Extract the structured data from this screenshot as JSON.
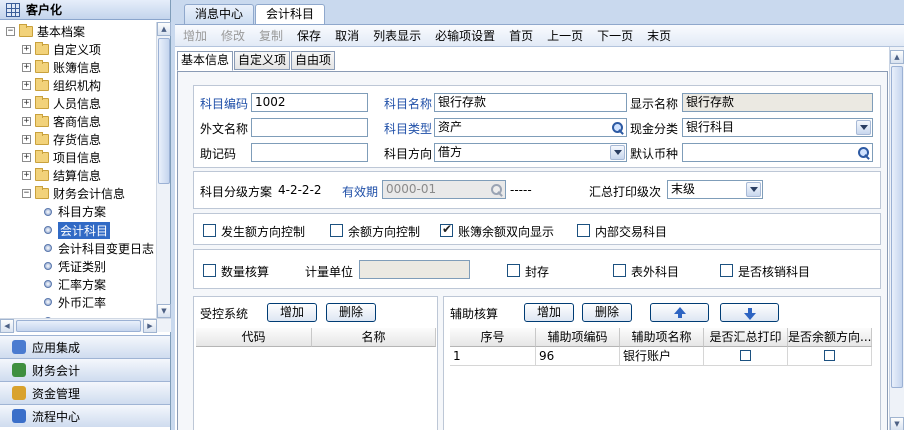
{
  "left_header": "客户化",
  "tree": [
    {
      "label": "基本档案",
      "level": 0,
      "toggle": "−",
      "type": "folder"
    },
    {
      "label": "自定义项",
      "level": 1,
      "toggle": "+",
      "type": "folder"
    },
    {
      "label": "账簿信息",
      "level": 1,
      "toggle": "+",
      "type": "folder"
    },
    {
      "label": "组织机构",
      "level": 1,
      "toggle": "+",
      "type": "folder"
    },
    {
      "label": "人员信息",
      "level": 1,
      "toggle": "+",
      "type": "folder"
    },
    {
      "label": "客商信息",
      "level": 1,
      "toggle": "+",
      "type": "folder"
    },
    {
      "label": "存货信息",
      "level": 1,
      "toggle": "+",
      "type": "folder"
    },
    {
      "label": "项目信息",
      "level": 1,
      "toggle": "+",
      "type": "folder"
    },
    {
      "label": "结算信息",
      "level": 1,
      "toggle": "+",
      "type": "folder"
    },
    {
      "label": "财务会计信息",
      "level": 1,
      "toggle": "−",
      "type": "folder"
    },
    {
      "label": "科目方案",
      "level": 2,
      "type": "leaf"
    },
    {
      "label": "会计科目",
      "level": 2,
      "type": "leaf",
      "selected": true
    },
    {
      "label": "会计科目变更日志",
      "level": 2,
      "type": "leaf"
    },
    {
      "label": "凭证类别",
      "level": 2,
      "type": "leaf"
    },
    {
      "label": "汇率方案",
      "level": 2,
      "type": "leaf"
    },
    {
      "label": "外币汇率",
      "level": 2,
      "type": "leaf"
    },
    {
      "label": "...",
      "level": 2,
      "type": "leaf"
    }
  ],
  "nav_bars": [
    {
      "label": "应用集成",
      "color": "#4a7bd0"
    },
    {
      "label": "财务会计",
      "color": "#3f8f3f"
    },
    {
      "label": "资金管理",
      "color": "#d9a22d"
    },
    {
      "label": "流程中心",
      "color": "#3b6fc9"
    }
  ],
  "tabs": [
    "消息中心",
    "会计科目"
  ],
  "toolbar": [
    {
      "label": "增加",
      "disabled": true
    },
    {
      "label": "修改",
      "disabled": true
    },
    {
      "label": "复制",
      "disabled": true
    },
    {
      "label": "保存",
      "disabled": false
    },
    {
      "label": "取消",
      "disabled": false
    },
    {
      "label": "列表显示",
      "disabled": false
    },
    {
      "label": "必输项设置",
      "disabled": false
    },
    {
      "label": "首页",
      "disabled": false
    },
    {
      "label": "上一页",
      "disabled": false
    },
    {
      "label": "下一页",
      "disabled": false
    },
    {
      "label": "末页",
      "disabled": false
    }
  ],
  "subtabs": [
    "基本信息",
    "自定义项",
    "自由项"
  ],
  "form": {
    "code_label": "科目编码",
    "code_value": "1002",
    "name_label": "科目名称",
    "name_value": "银行存款",
    "display_label": "显示名称",
    "display_value": "银行存款",
    "foreign_label": "外文名称",
    "foreign_value": "",
    "type_label": "科目类型",
    "type_value": "资产",
    "cash_label": "现金分类",
    "cash_value": "银行科目",
    "mnemonic_label": "助记码",
    "mnemonic_value": "",
    "direction_label": "科目方向",
    "direction_value": "借方",
    "currency_label": "默认币种",
    "currency_value": "",
    "level_scheme_label": "科目分级方案",
    "level_scheme_value": "4-2-2-2",
    "valid_label": "有效期",
    "valid_from": "0000-01",
    "valid_sep": "-----",
    "print_level_label": "汇总打印级次",
    "print_level_value": "末级",
    "cb_amount_dir": "发生额方向控制",
    "cb_balance_dir": "余额方向控制",
    "cb_ledger_both": "账簿余额双向显示",
    "cb_internal": "内部交易科目",
    "cb_qty": "数量核算",
    "unit_label": "计量单位",
    "unit_value": "",
    "cb_seal": "封存",
    "cb_offsheet": "表外科目",
    "cb_writeoff": "是否核销科目"
  },
  "controlled": {
    "title": "受控系统",
    "add": "增加",
    "delete": "删除",
    "columns": [
      "代码",
      "名称"
    ]
  },
  "aux": {
    "title": "辅助核算",
    "add": "增加",
    "delete": "删除",
    "columns": [
      "序号",
      "辅助项编码",
      "辅助项名称",
      "是否汇总打印",
      "是否余额方向..."
    ],
    "rows": [
      {
        "seq": "1",
        "code": "96",
        "name": "银行账户"
      }
    ]
  }
}
